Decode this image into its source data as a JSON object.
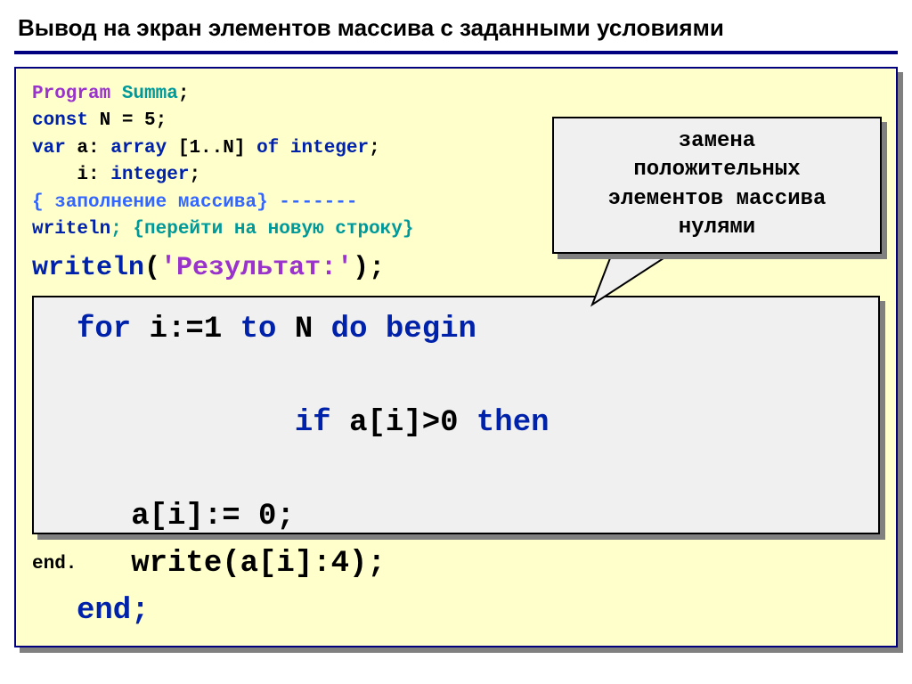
{
  "title": "Вывод на экран элементов массива с заданными условиями",
  "code": {
    "l1_kw": "Program",
    "l1_name": " Summa",
    "l2_kw": "const",
    "l2_rest": " N = 5;",
    "l3_kw": "var",
    "l3_rest": " a: ",
    "l3_arr": "array",
    "l3_mid": " [1..N] ",
    "l3_of": "of",
    "l3_type": " integer",
    "l4_indent": "    i: ",
    "l4_type": "integer",
    "l5_open": "{ ",
    "l5_text": "заполнение массива",
    "l5_close": "} -------",
    "l6_kw": "writeln",
    "l6_rest": "; {перейти на новую строку}",
    "result_kw": "writeln",
    "result_paren": "(",
    "result_str": "'Результат:'",
    "result_close": ");",
    "end_dot": "end."
  },
  "inner": {
    "l1a": "for",
    "l1b": " i:=1 ",
    "l1c": "to",
    "l1d": " N ",
    "l1e": "do begin",
    "l2a": "  if",
    "l2b": " a[i]>0 ",
    "l2c": "then",
    "l3": "   a[i]:= 0;",
    "l4": "   write(a[i]:4);",
    "l5": "end;"
  },
  "callout": {
    "line1": "замена",
    "line2": "положительных",
    "line3": "элементов массива",
    "line4": "нулями"
  }
}
